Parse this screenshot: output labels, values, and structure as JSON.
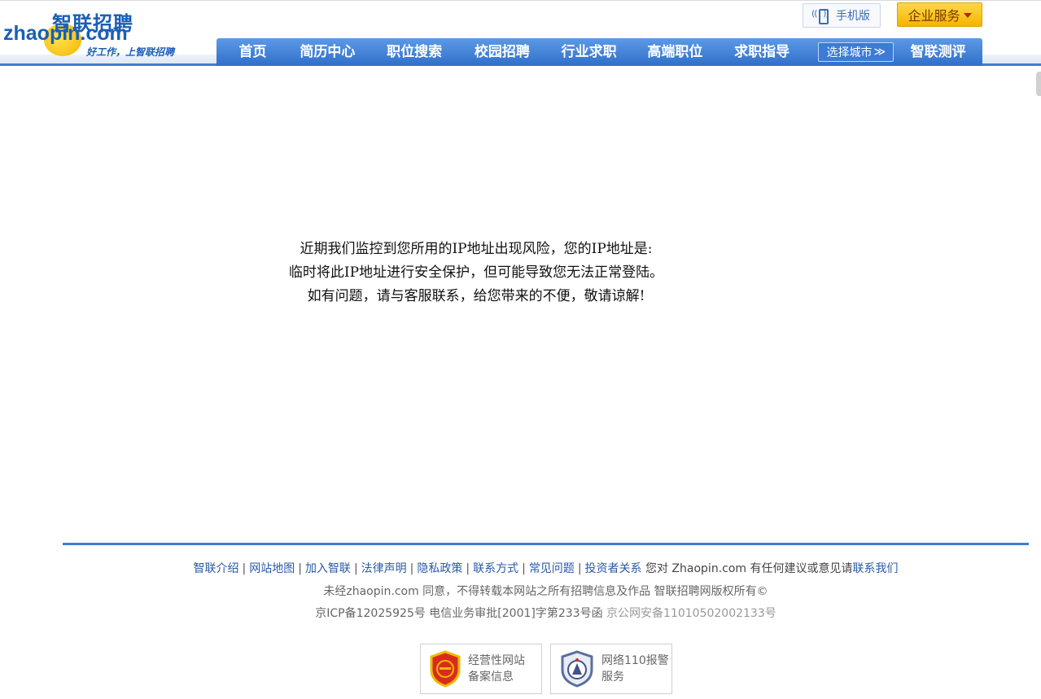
{
  "header": {
    "logo_cn": "智联招聘",
    "logo_en": "zhaopin.com",
    "slogan": "好工作，上智联招聘",
    "mobile_label": "手机版",
    "enterprise_label": "企业服务",
    "nav": [
      {
        "label": "首页"
      },
      {
        "label": "简历中心"
      },
      {
        "label": "职位搜索"
      },
      {
        "label": "校园招聘"
      },
      {
        "label": "行业求职"
      },
      {
        "label": "高端职位"
      },
      {
        "label": "求职指导"
      }
    ],
    "city_label": "选择城市",
    "city_chevron": "≫",
    "last_nav": "智联测评"
  },
  "message": {
    "line1": "近期我们监控到您所用的IP地址出现风险，您的IP地址是:",
    "line2": "临时将此IP地址进行安全保护，但可能导致您无法正常登陆。",
    "line3": "如有问题，请与客服联系，给您带来的不便，敬请谅解!"
  },
  "footer": {
    "links": [
      "智联介绍",
      "网站地图",
      "加入智联",
      "法律声明",
      "隐私政策",
      "联系方式",
      "常见问题",
      "投资者关系"
    ],
    "suggest_prefix": "您对 Zhaopin.com 有任何建议或意见请",
    "contact_link": "联系我们",
    "copyright": "未经zhaopin.com 同意，不得转载本网站之所有招聘信息及作品 智联招聘网版权所有©",
    "icp": "京ICP备12025925号 电信业务审批[2001]字第233号函",
    "police": "京公网安备11010502002133号",
    "badge1_line1": "经营性网站",
    "badge1_line2": "备案信息",
    "badge2_line1": "网络110报警",
    "badge2_line2": "服务"
  },
  "colors": {
    "nav_blue": "#3f7ed2",
    "link_blue": "#2a5aa8",
    "enterprise_yellow": "#f5b400"
  }
}
